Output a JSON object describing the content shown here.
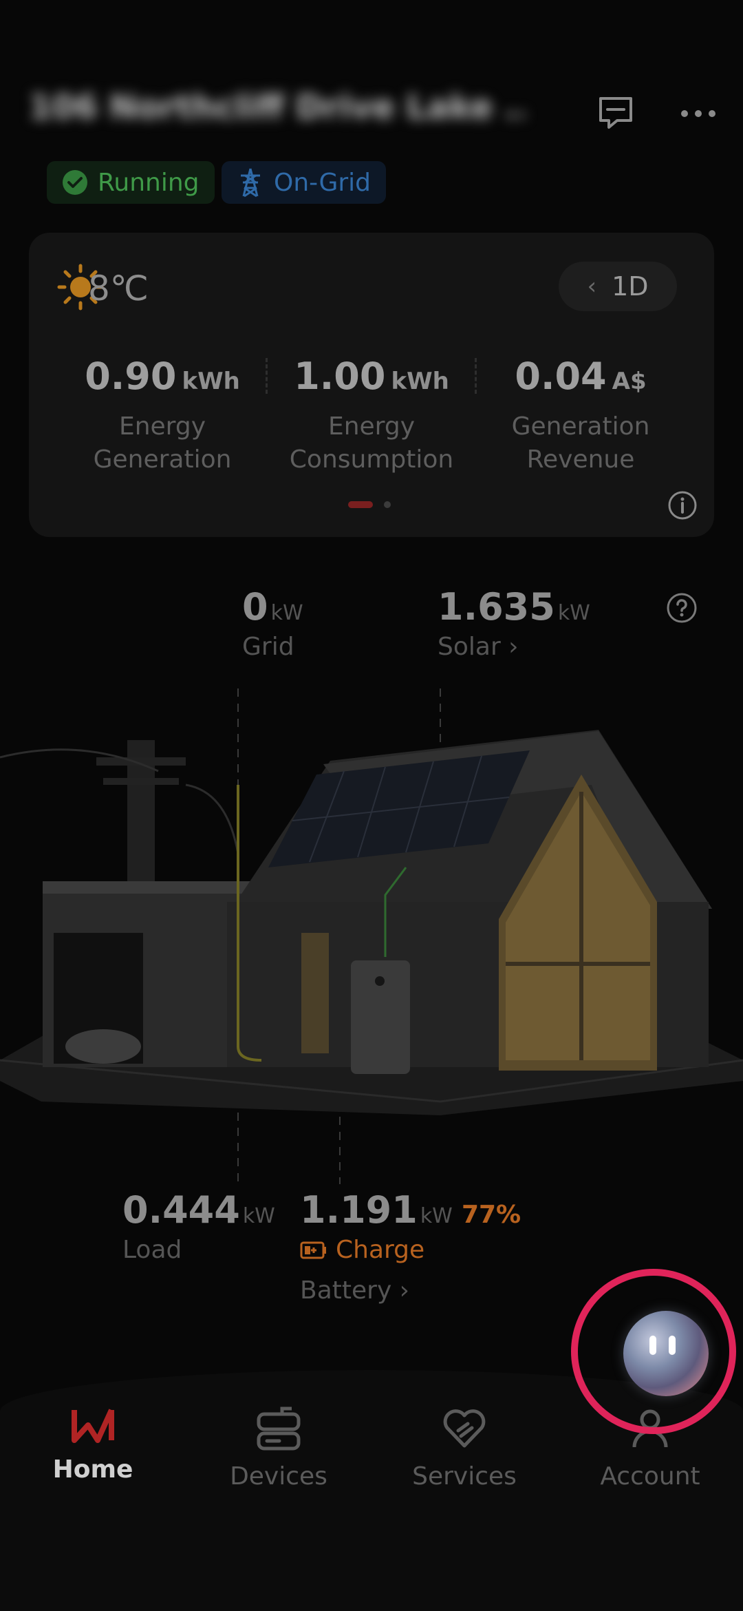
{
  "header": {
    "site_name": "106 Northcliff Drive Lake ..."
  },
  "status": {
    "running_label": "Running",
    "grid_label": "On-Grid"
  },
  "weather": {
    "temperature": "8℃",
    "period": "1D"
  },
  "summary": [
    {
      "value": "0.90",
      "unit": "kWh",
      "label_line1": "Energy",
      "label_line2": "Generation"
    },
    {
      "value": "1.00",
      "unit": "kWh",
      "label_line1": "Energy",
      "label_line2": "Consumption"
    },
    {
      "value": "0.04",
      "unit": "A$",
      "label_line1": "Generation",
      "label_line2": "Revenue"
    }
  ],
  "flow": {
    "grid": {
      "value": "0",
      "unit": "kW",
      "label": "Grid"
    },
    "solar": {
      "value": "1.635",
      "unit": "kW",
      "label": "Solar ›"
    },
    "load": {
      "value": "0.444",
      "unit": "kW",
      "label": "Load"
    },
    "battery": {
      "value": "1.191",
      "unit": "kW",
      "soc": "77%",
      "state": "Charge",
      "label": "Battery ›"
    }
  },
  "nav": {
    "home": "Home",
    "devices": "Devices",
    "services": "Services",
    "account": "Account"
  },
  "colors": {
    "accent_red": "#c62828",
    "running_green": "#3f9a48",
    "grid_blue": "#2f6aa8",
    "battery_orange": "#b8621f",
    "highlight_ring": "#e0245a"
  }
}
